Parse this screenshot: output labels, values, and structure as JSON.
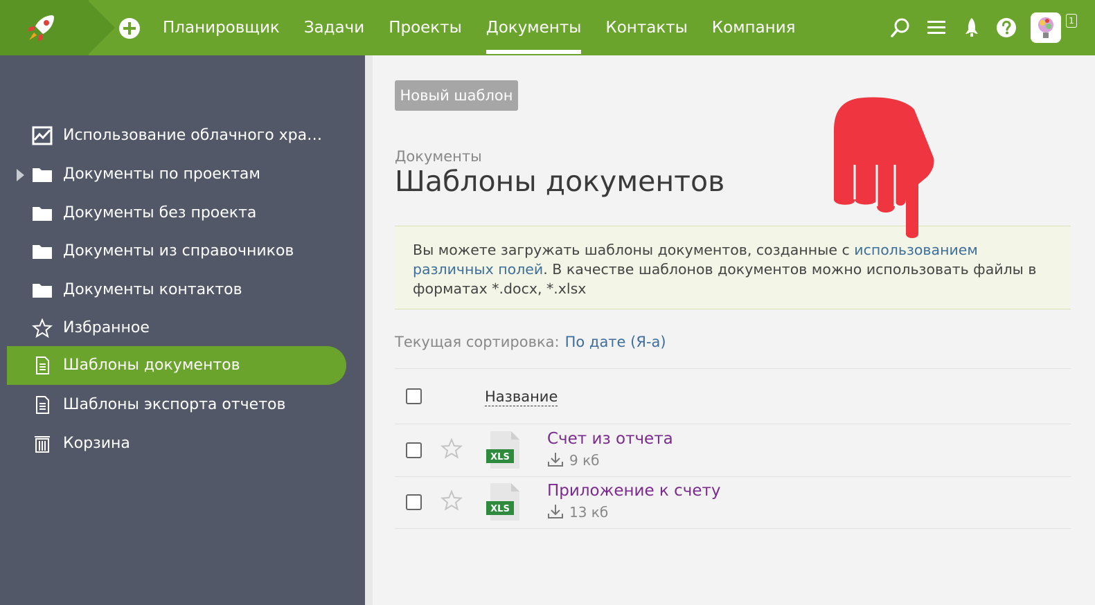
{
  "topbar": {
    "nav": [
      "Планировщик",
      "Задачи",
      "Проекты",
      "Документы",
      "Контакты",
      "Компания"
    ],
    "active_nav": "Документы",
    "icons": [
      "search-icon",
      "menu-icon",
      "rocket-icon",
      "help-icon"
    ],
    "notification_count": "1",
    "accent_color": "#6aa42c"
  },
  "sidebar": {
    "items": [
      {
        "label": "Использование облачного хра…",
        "icon": "chart-icon"
      },
      {
        "label": "Документы по проектам",
        "icon": "folder-icon"
      },
      {
        "label": "Документы без проекта",
        "icon": "folder-icon"
      },
      {
        "label": "Документы из справочников",
        "icon": "folder-icon"
      },
      {
        "label": "Документы контактов",
        "icon": "folder-icon"
      },
      {
        "label": "Избранное",
        "icon": "star-icon"
      },
      {
        "label": "Шаблоны документов",
        "icon": "document-icon",
        "active": true
      },
      {
        "label": "Шаблоны экспорта отчетов",
        "icon": "document-icon"
      },
      {
        "label": "Корзина",
        "icon": "trash-icon"
      }
    ]
  },
  "main": {
    "new_template_button": "Новый шаблон",
    "breadcrumb": "Документы",
    "title": "Шаблоны документов",
    "info": {
      "text_before": "Вы можете загружать шаблоны документов, созданные с ",
      "link_line1": "использованием",
      "link_line2": "различных полей",
      "text_line2_after": ". В качестве шаблонов документов можно использовать файлы в",
      "text_line3": "форматах *.docx, *.xlsx"
    },
    "sort_label": "Текущая сортировка:",
    "sort_value": "По дате (Я-а)",
    "table": {
      "column_name": "Название",
      "rows": [
        {
          "name": "Счет из отчета",
          "size": "9 кб",
          "type": "XLS"
        },
        {
          "name": "Приложение к счету",
          "size": "13 кб",
          "type": "XLS"
        }
      ]
    }
  }
}
